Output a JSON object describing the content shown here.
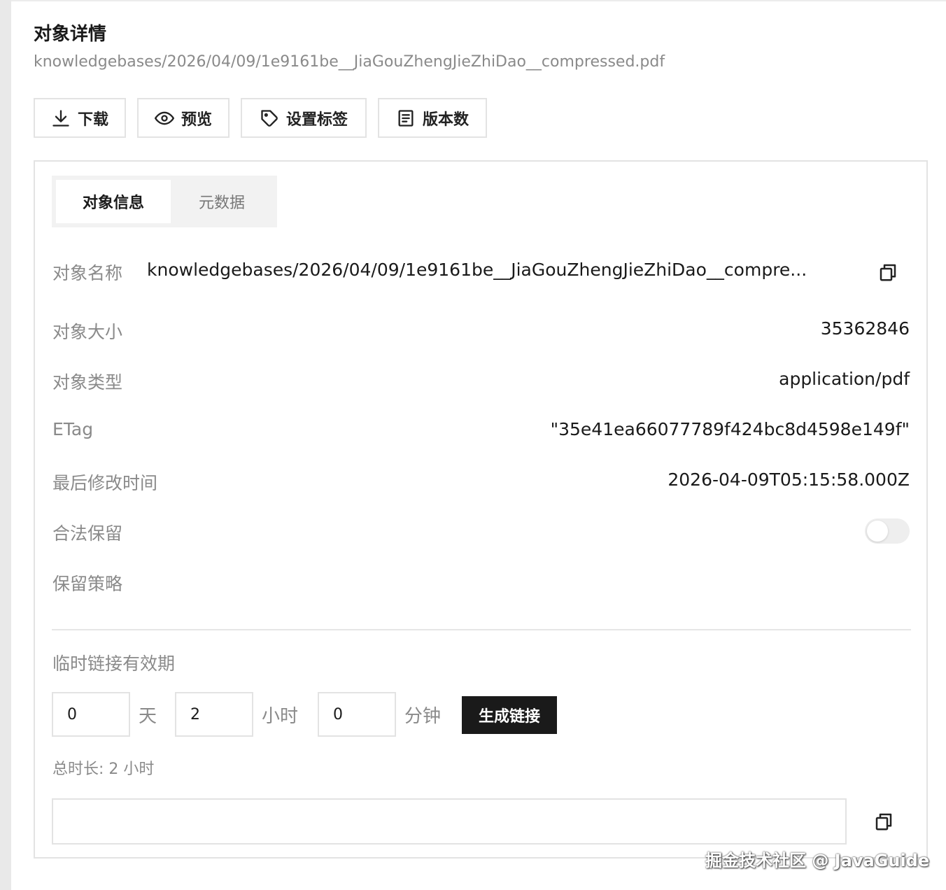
{
  "page": {
    "title": "对象详情",
    "object_path": "knowledgebases/2026/04/09/1e9161be__JiaGouZhengJieZhiDao__compressed.pdf"
  },
  "toolbar": {
    "download_label": "下载",
    "preview_label": "预览",
    "set_tags_label": "设置标签",
    "versions_label": "版本数"
  },
  "tabs": {
    "object_info": "对象信息",
    "metadata": "元数据"
  },
  "info": {
    "name_label": "对象名称",
    "name_value": "knowledgebases/2026/04/09/1e9161be__JiaGouZhengJieZhiDao__compre...",
    "size_label": "对象大小",
    "size_value": "35362846",
    "type_label": "对象类型",
    "type_value": "application/pdf",
    "etag_label": "ETag",
    "etag_value": "\"35e41ea66077789f424bc8d4598e149f\"",
    "modified_label": "最后修改时间",
    "modified_value": "2026-04-09T05:15:58.000Z",
    "legal_hold_label": "合法保留",
    "legal_hold_on": false,
    "retention_label": "保留策略"
  },
  "temp_link": {
    "label": "临时链接有效期",
    "days_value": "0",
    "days_unit": "天",
    "hours_value": "2",
    "hours_unit": "小时",
    "minutes_value": "0",
    "minutes_unit": "分钟",
    "generate_label": "生成链接",
    "total_text": "总时长: 2 小时",
    "link_value": ""
  },
  "watermark": "掘金技术社区 @ JavaGuide"
}
